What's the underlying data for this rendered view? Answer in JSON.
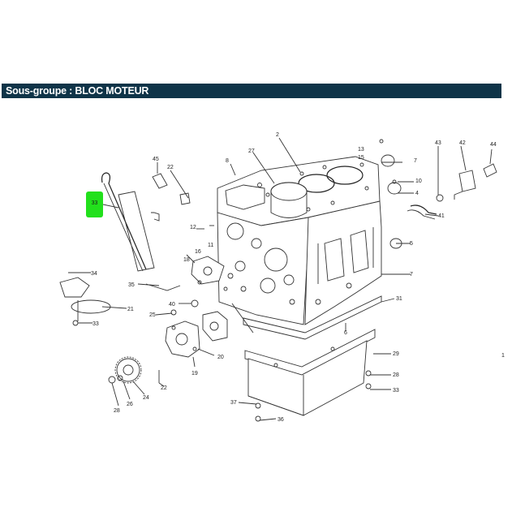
{
  "header": {
    "title": "Sous-groupe : BLOC MOTEUR"
  },
  "highlight": {
    "label": "33",
    "color": "#22e01c"
  },
  "callouts": [
    {
      "id": "c1",
      "text": "1"
    },
    {
      "id": "c2",
      "text": "2"
    },
    {
      "id": "c4",
      "text": "4"
    },
    {
      "id": "c5",
      "text": "5"
    },
    {
      "id": "c6",
      "text": "6"
    },
    {
      "id": "c7",
      "text": "7"
    },
    {
      "id": "c8",
      "text": "8"
    },
    {
      "id": "c10",
      "text": "10"
    },
    {
      "id": "c11",
      "text": "11"
    },
    {
      "id": "c12a",
      "text": "12"
    },
    {
      "id": "c12b",
      "text": "12"
    },
    {
      "id": "c12c",
      "text": "12"
    },
    {
      "id": "c13",
      "text": "13"
    },
    {
      "id": "c14",
      "text": "14"
    },
    {
      "id": "c15",
      "text": "15"
    },
    {
      "id": "c16",
      "text": "16"
    },
    {
      "id": "c18",
      "text": "18"
    },
    {
      "id": "c19",
      "text": "19"
    },
    {
      "id": "c20",
      "text": "20"
    },
    {
      "id": "c21",
      "text": "21"
    },
    {
      "id": "c22",
      "text": "22"
    },
    {
      "id": "c22b",
      "text": "22"
    },
    {
      "id": "c24",
      "text": "24"
    },
    {
      "id": "c25",
      "text": "25"
    },
    {
      "id": "c26",
      "text": "26"
    },
    {
      "id": "c27",
      "text": "27"
    },
    {
      "id": "c28",
      "text": "28"
    },
    {
      "id": "c29",
      "text": "29"
    },
    {
      "id": "c31",
      "text": "31"
    },
    {
      "id": "c33a",
      "text": "33"
    },
    {
      "id": "c33b",
      "text": "33"
    },
    {
      "id": "c34",
      "text": "34"
    },
    {
      "id": "c35",
      "text": "35"
    },
    {
      "id": "c36",
      "text": "36"
    },
    {
      "id": "c37",
      "text": "37"
    },
    {
      "id": "c40",
      "text": "40"
    },
    {
      "id": "c41",
      "text": "41"
    },
    {
      "id": "c42",
      "text": "42"
    },
    {
      "id": "c43",
      "text": "43"
    },
    {
      "id": "c44",
      "text": "44"
    },
    {
      "id": "c45",
      "text": "45"
    },
    {
      "id": "c46",
      "text": "46"
    },
    {
      "id": "c7b",
      "text": "7"
    }
  ]
}
